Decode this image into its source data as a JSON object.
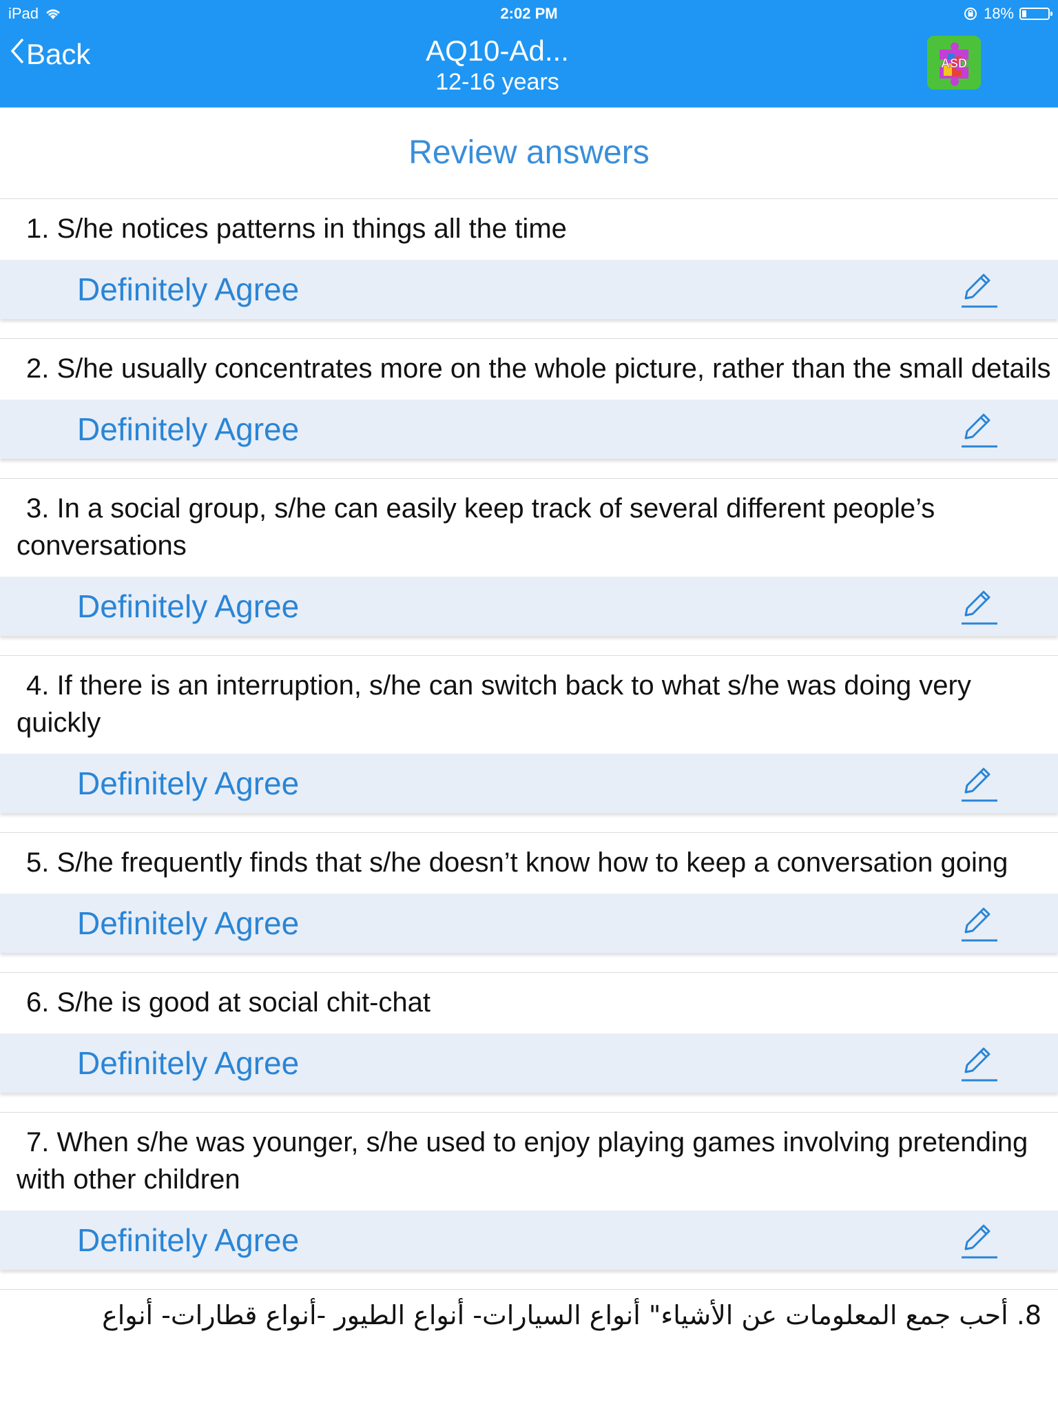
{
  "status_bar": {
    "device": "iPad",
    "time": "2:02 PM",
    "battery": "18%",
    "battery_level": 0.18
  },
  "nav": {
    "back_label": "Back",
    "title": "AQ10-Ad...",
    "subtitle": "12-16 years",
    "logo_icon": "asd-puzzle-logo-icon"
  },
  "section_title": "Review answers",
  "questions": [
    {
      "text": "1. S/he notices patterns in things all the time",
      "answer": "Definitely Agree"
    },
    {
      "text": "2. S/he usually concentrates more on the whole picture, rather than the small details",
      "answer": "Definitely Agree"
    },
    {
      "text": "3. In a social group, s/he can easily keep track of several different people’s conversations",
      "answer": "Definitely Agree"
    },
    {
      "text": "4. If there is an interruption, s/he can switch back to what s/he was doing very quickly",
      "answer": "Definitely Agree"
    },
    {
      "text": "5. S/he frequently finds that s/he doesn’t know how to keep a conversation going",
      "answer": "Definitely Agree"
    },
    {
      "text": "6. S/he is good at social chit-chat",
      "answer": "Definitely Agree"
    },
    {
      "text": "7. When s/he was younger, s/he used to enjoy playing games involving pretending with other children",
      "answer": "Definitely Agree"
    }
  ],
  "partial_question": {
    "text": "8. أحب جمع المعلومات عن الأشياء\" أنواع السيارات- أنواع الطيور -أنواع قطارات- أنواع"
  },
  "colors": {
    "header": "#1f96f3",
    "accent": "#2a85d6",
    "answer_bg": "#e8eef7"
  }
}
